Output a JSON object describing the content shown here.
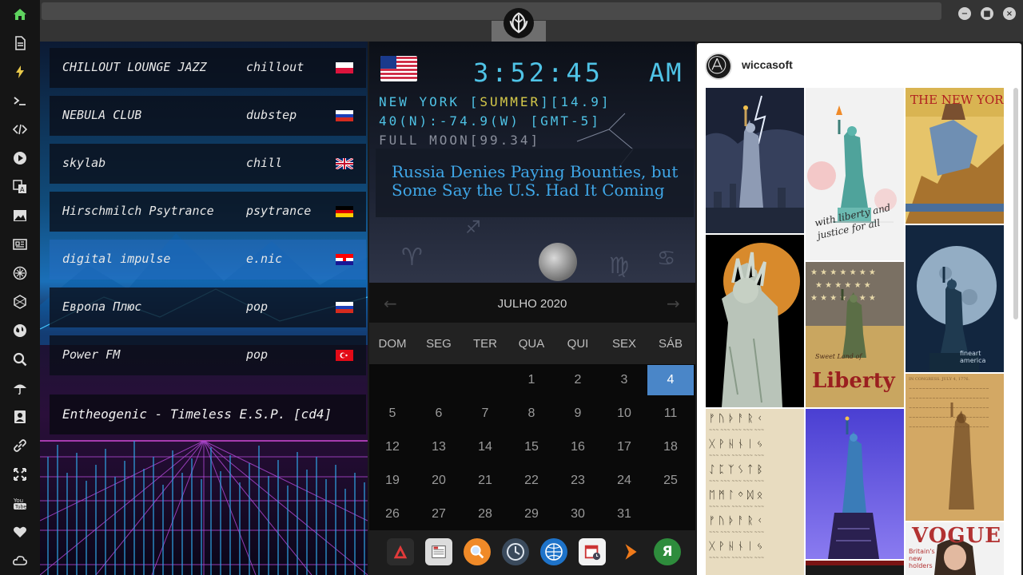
{
  "sidebar": {
    "icons": [
      "home-icon",
      "document-icon",
      "lightning-icon",
      "terminal-icon",
      "code-icon",
      "play-icon",
      "translate-icon",
      "image-icon",
      "news-icon",
      "settings-wheel-icon",
      "hexagon-icon",
      "globe-icon",
      "search-icon",
      "umbrella-icon",
      "contact-icon",
      "link-icon",
      "expand-icon",
      "youtube-icon",
      "heart-icon",
      "cloud-icon"
    ]
  },
  "radio": {
    "stations": [
      {
        "name": "CHILLOUT LOUNGE JAZZ",
        "genre": "chillout",
        "flag": "pl"
      },
      {
        "name": "NEBULA CLUB",
        "genre": "dubstep",
        "flag": "ru"
      },
      {
        "name": "skylab",
        "genre": "chill",
        "flag": "uk"
      },
      {
        "name": "Hirschmilch Psytrance",
        "genre": "psytrance",
        "flag": "de"
      },
      {
        "name": "digital impulse",
        "genre": "e.nic",
        "flag": "hr"
      },
      {
        "name": "Европа Плюс",
        "genre": "pop",
        "flag": "ru"
      },
      {
        "name": "Power FM",
        "genre": "pop",
        "flag": "tr"
      }
    ],
    "now_playing": "Entheogenic - Timeless E.S.P. [cd4]"
  },
  "clock": {
    "time": "3:52:45",
    "ampm": "AM",
    "city_line": "NEW YORK [",
    "season": "SUMMER",
    "temp": "][14.9]",
    "coords": "40(N):-74.9(W) [GMT-5]",
    "moon": "FULL MOON[99.34]"
  },
  "news": {
    "headline": "Russia Denies Paying Bounties, but Some Say the U.S. Had It Coming"
  },
  "calendar": {
    "month": "JULHO 2020",
    "weekdays": [
      "DOM",
      "SEG",
      "TER",
      "QUA",
      "QUI",
      "SEX",
      "SÁB"
    ],
    "days": [
      [
        "",
        "",
        "",
        "1",
        "2",
        "3",
        "4"
      ],
      [
        "5",
        "6",
        "7",
        "8",
        "9",
        "10",
        "11"
      ],
      [
        "12",
        "13",
        "14",
        "15",
        "16",
        "17",
        "18"
      ],
      [
        "19",
        "20",
        "21",
        "22",
        "23",
        "24",
        "25"
      ],
      [
        "26",
        "27",
        "28",
        "29",
        "30",
        "31",
        ""
      ]
    ],
    "today": "4"
  },
  "dock": {
    "apps": [
      "app-a-icon",
      "calendar-app-icon",
      "search-app-icon",
      "clock-app-icon",
      "browser-icon",
      "schedule-icon",
      "arrow-app-icon",
      "yandex-icon"
    ]
  },
  "gallery": {
    "username": "wiccasoft",
    "captions": {
      "liberty_script": "with liberty and justice for all",
      "new_yorker": "THE NEW YORKER",
      "sweet_land": "Sweet Land of",
      "liberty_word": "Liberty",
      "fine_art": "fineart america",
      "vogue": "VOGUE",
      "vogue_sub": "Britain's new holders"
    }
  },
  "colors": {
    "accent": "#4fc3e6",
    "season": "#d6c94a",
    "today": "#4a86c8",
    "news": "#3fa7e8"
  }
}
